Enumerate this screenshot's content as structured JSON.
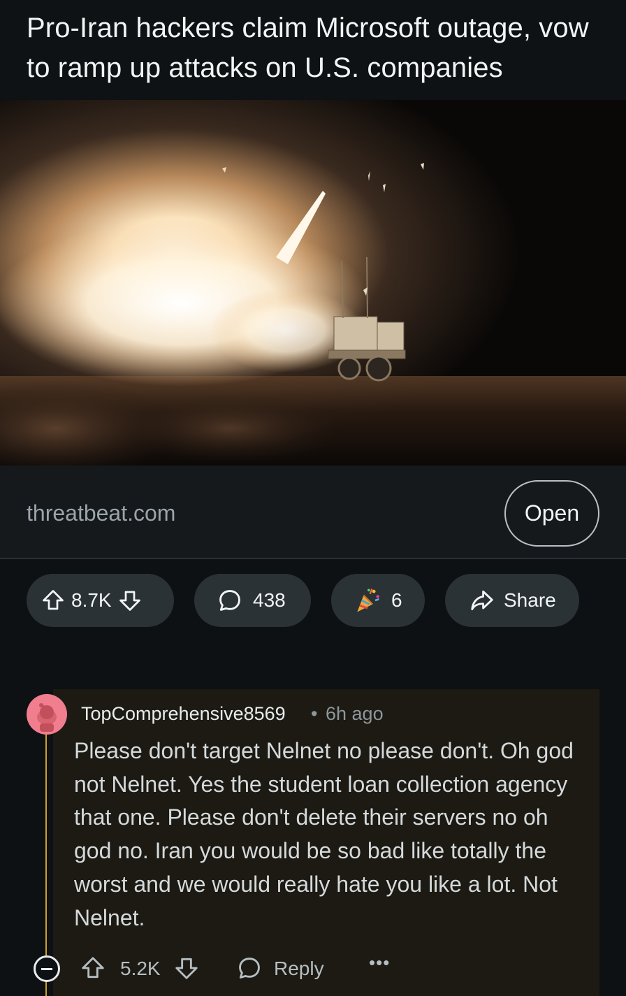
{
  "post": {
    "title": "Pro-Iran hackers claim Microsoft outage, vow to ramp up attacks on U.S. companies",
    "domain": "threatbeat.com",
    "open_label": "Open"
  },
  "actions": {
    "votes": "8.7K",
    "comments": "438",
    "awards": "6",
    "share_label": "Share"
  },
  "comment": {
    "author": "TopComprehensive8569",
    "separator": "•",
    "time": "6h ago",
    "body": "Please don't target Nelnet no please don't. Oh god not Nelnet. Yes the student loan collection agency that one. Please don't delete their servers no oh god no. Iran you would be so bad like totally the worst and we would really hate you like a lot. Not Nelnet.",
    "votes": "5.2K",
    "reply_label": "Reply",
    "more_label": "•••"
  },
  "colors": {
    "background": "#0e1113",
    "pill": "#2a3236",
    "thread_line": "#c9a227",
    "avatar": "#f07e8e"
  },
  "icons": [
    "upvote-icon",
    "downvote-icon",
    "comment-icon",
    "award-icon",
    "share-icon",
    "collapse-icon",
    "reply-icon",
    "more-icon"
  ]
}
